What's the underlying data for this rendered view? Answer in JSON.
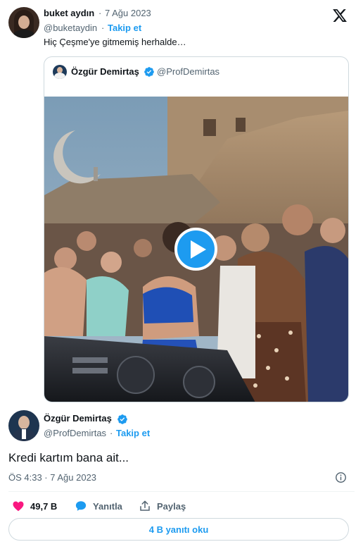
{
  "outer_tweet": {
    "name": "buket aydın",
    "separator": "·",
    "date": "7 Ağu 2023",
    "handle": "@buketaydin",
    "handle_separator": "·",
    "follow_label": "Takip et",
    "text": "Hiç Çeşme'ye gitmemiş herhalde…"
  },
  "quoted_tweet": {
    "name": "Özgür Demirtaş",
    "handle": "@ProfDemirtas"
  },
  "main_tweet": {
    "name": "Özgür Demirtaş",
    "handle": "@ProfDemirtas",
    "handle_separator": "·",
    "follow_label": "Takip et",
    "text": "Kredi kartım bana ait...",
    "timestamp": "ÖS 4:33 · 7 Ağu 2023"
  },
  "actions": {
    "likes": "49,7 B",
    "reply_label": "Yanıtla",
    "share_label": "Paylaş"
  },
  "read_replies_label": "4 B yanıtı oku",
  "colors": {
    "accent": "#1d9bf0",
    "like": "#f91880",
    "text": "#0f1419",
    "muted": "#536471"
  },
  "icons": {
    "brand": "x-logo-icon",
    "verified": "verified-badge-icon",
    "play": "play-icon",
    "like": "heart-icon",
    "reply": "comment-bubble-icon",
    "share": "share-upload-icon",
    "info": "info-icon"
  }
}
